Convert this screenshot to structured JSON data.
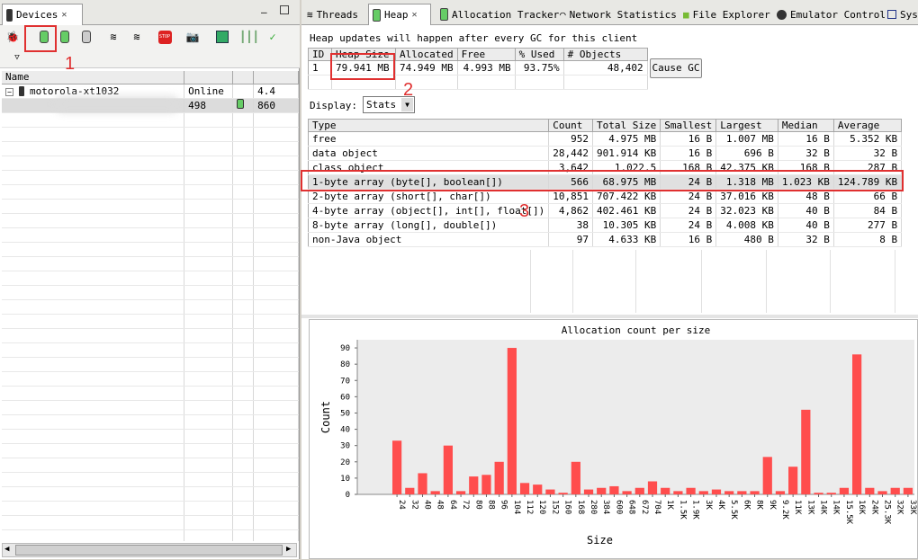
{
  "devices_panel": {
    "tab_label": "Devices",
    "columns": [
      "Name",
      "",
      "",
      ""
    ],
    "device": {
      "name": "motorola-xt1032",
      "status": "Online",
      "version": "4.4"
    },
    "process": {
      "pid": "498",
      "port": "860"
    }
  },
  "tabs": [
    "Threads",
    "Heap",
    "Allocation Tracker",
    "Network Statistics",
    "File Explorer",
    "Emulator Control",
    "Sys"
  ],
  "heap": {
    "info": "Heap updates will happen after every GC for this client",
    "summary_headers": [
      "ID",
      "Heap Size",
      "Allocated",
      "Free",
      "% Used",
      "# Objects"
    ],
    "summary_row": [
      "1",
      "79.941 MB",
      "74.949 MB",
      "4.993 MB",
      "93.75%",
      "48,402"
    ],
    "cause_gc": "Cause GC",
    "display_label": "Display:",
    "display_value": "Stats",
    "stats_headers": [
      "Type",
      "Count",
      "Total Size",
      "Smallest",
      "Largest",
      "Median",
      "Average"
    ],
    "stats_rows": [
      [
        "free",
        "952",
        "4.975 MB",
        "16 B",
        "1.007 MB",
        "16 B",
        "5.352 KB"
      ],
      [
        "data object",
        "28,442",
        "901.914 KB",
        "16 B",
        "696 B",
        "32 B",
        "32 B"
      ],
      [
        "class object",
        "3,642",
        "1.022.5",
        "168 B",
        "42.375 KB",
        "168 B",
        "287 B"
      ],
      [
        "1-byte array (byte[], boolean[])",
        "566",
        "68.975 MB",
        "24 B",
        "1.318 MB",
        "1.023 KB",
        "124.789 KB"
      ],
      [
        "2-byte array (short[], char[])",
        "10,851",
        "707.422 KB",
        "24 B",
        "37.016 KB",
        "48 B",
        "66 B"
      ],
      [
        "4-byte array (object[], int[], float[])",
        "4,862",
        "402.461 KB",
        "24 B",
        "32.023 KB",
        "40 B",
        "84 B"
      ],
      [
        "8-byte array (long[], double[])",
        "38",
        "10.305 KB",
        "24 B",
        "4.008 KB",
        "40 B",
        "277 B"
      ],
      [
        "non-Java object",
        "97",
        "4.633 KB",
        "16 B",
        "480 B",
        "32 B",
        "8 B"
      ]
    ]
  },
  "annotations": [
    "1",
    "2",
    "3"
  ],
  "chart_data": {
    "type": "bar",
    "title": "Allocation count per size",
    "xlabel": "Size",
    "ylabel": "Count",
    "ylim": [
      0,
      95
    ],
    "yticks": [
      0,
      10,
      20,
      30,
      40,
      50,
      60,
      70,
      80,
      90
    ],
    "bar_color": "#ff4d4d",
    "categories": [
      "24",
      "32",
      "40",
      "48",
      "64",
      "72",
      "80",
      "88",
      "96",
      "104",
      "112",
      "120",
      "152",
      "160",
      "168",
      "280",
      "384",
      "600",
      "648",
      "672",
      "704",
      "1K",
      "1.5K",
      "1.9K",
      "3K",
      "4K",
      "5.5K",
      "6K",
      "8K",
      "9K",
      "9.2K",
      "11K",
      "13K",
      "14K",
      "14K",
      "15.5K",
      "16K",
      "24K",
      "25.3K",
      "32K",
      "33K"
    ],
    "values": [
      33,
      4,
      13,
      2,
      30,
      2,
      11,
      12,
      20,
      90,
      7,
      6,
      3,
      1,
      20,
      3,
      4,
      5,
      2,
      4,
      8,
      4,
      2,
      4,
      2,
      3,
      2,
      2,
      2,
      23,
      2,
      17,
      52,
      1,
      1,
      4,
      86,
      4,
      2,
      4,
      4
    ]
  }
}
